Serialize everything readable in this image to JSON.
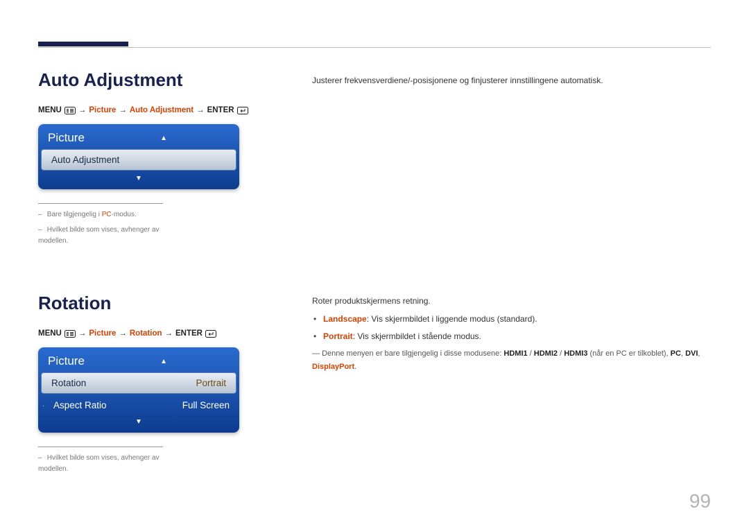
{
  "section1": {
    "heading": "Auto Adjustment",
    "breadcrumb": {
      "menu": "MENU",
      "sep": "→",
      "p1": "Picture",
      "p2": "Auto Adjustment",
      "enter": "ENTER"
    },
    "panel": {
      "title": "Picture",
      "row1_label": "Auto Adjustment"
    },
    "footnotes": {
      "n1_pre": "Bare tilgjengelig i ",
      "n1_hl": "PC",
      "n1_post": "-modus.",
      "n2": "Hvilket bilde som vises, avhenger av modellen."
    },
    "right_desc": "Justerer frekvensverdiene/-posisjonene og finjusterer innstillingene automatisk."
  },
  "section2": {
    "heading": "Rotation",
    "breadcrumb": {
      "menu": "MENU",
      "sep": "→",
      "p1": "Picture",
      "p2": "Rotation",
      "enter": "ENTER"
    },
    "panel": {
      "title": "Picture",
      "row1_label": "Rotation",
      "row1_value": "Portrait",
      "row2_label": "Aspect Ratio",
      "row2_value": "Full Screen"
    },
    "footnotes": {
      "n1": "Hvilket bilde som vises, avhenger av modellen."
    },
    "right": {
      "intro": "Roter produktskjermens retning.",
      "li1_hl": "Landscape",
      "li1_rest": ": Vis skjermbildet i liggende modus (standard).",
      "li2_hl": "Portrait",
      "li2_rest": ": Vis skjermbildet i stående modus.",
      "note_pre": "Denne menyen er bare tilgjengelig i disse modusene: ",
      "note_h1": "HDMI1",
      "note_h2": "HDMI2",
      "note_h3": "HDMI3",
      "note_mid": " (når en PC er tilkoblet), ",
      "note_pc": "PC",
      "note_dvi": "DVI",
      "note_dp": "DisplayPort",
      "note_sep": " / ",
      "note_comma": ", ",
      "note_end": "."
    }
  },
  "page_number": "99"
}
